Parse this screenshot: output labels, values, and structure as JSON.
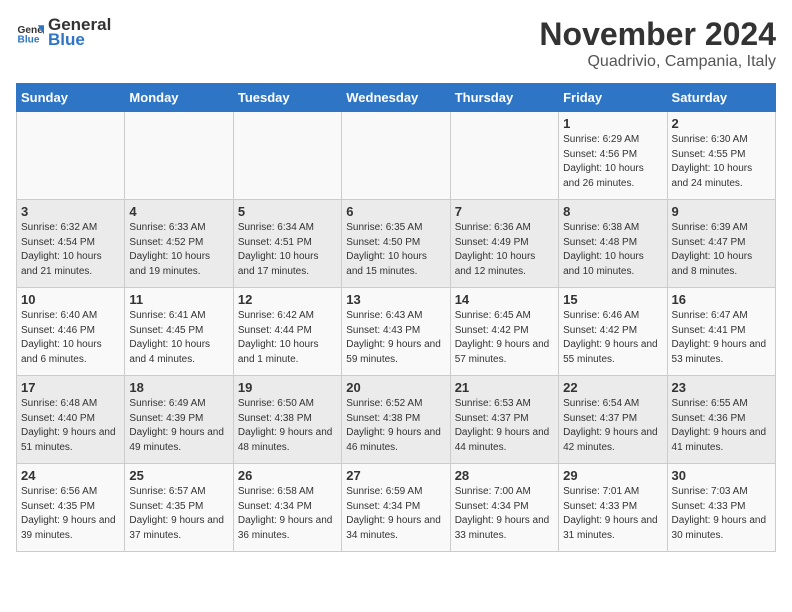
{
  "header": {
    "logo_general": "General",
    "logo_blue": "Blue",
    "title": "November 2024",
    "subtitle": "Quadrivio, Campania, Italy"
  },
  "days_of_week": [
    "Sunday",
    "Monday",
    "Tuesday",
    "Wednesday",
    "Thursday",
    "Friday",
    "Saturday"
  ],
  "weeks": [
    [
      {
        "day": "",
        "info": ""
      },
      {
        "day": "",
        "info": ""
      },
      {
        "day": "",
        "info": ""
      },
      {
        "day": "",
        "info": ""
      },
      {
        "day": "",
        "info": ""
      },
      {
        "day": "1",
        "info": "Sunrise: 6:29 AM\nSunset: 4:56 PM\nDaylight: 10 hours and 26 minutes."
      },
      {
        "day": "2",
        "info": "Sunrise: 6:30 AM\nSunset: 4:55 PM\nDaylight: 10 hours and 24 minutes."
      }
    ],
    [
      {
        "day": "3",
        "info": "Sunrise: 6:32 AM\nSunset: 4:54 PM\nDaylight: 10 hours and 21 minutes."
      },
      {
        "day": "4",
        "info": "Sunrise: 6:33 AM\nSunset: 4:52 PM\nDaylight: 10 hours and 19 minutes."
      },
      {
        "day": "5",
        "info": "Sunrise: 6:34 AM\nSunset: 4:51 PM\nDaylight: 10 hours and 17 minutes."
      },
      {
        "day": "6",
        "info": "Sunrise: 6:35 AM\nSunset: 4:50 PM\nDaylight: 10 hours and 15 minutes."
      },
      {
        "day": "7",
        "info": "Sunrise: 6:36 AM\nSunset: 4:49 PM\nDaylight: 10 hours and 12 minutes."
      },
      {
        "day": "8",
        "info": "Sunrise: 6:38 AM\nSunset: 4:48 PM\nDaylight: 10 hours and 10 minutes."
      },
      {
        "day": "9",
        "info": "Sunrise: 6:39 AM\nSunset: 4:47 PM\nDaylight: 10 hours and 8 minutes."
      }
    ],
    [
      {
        "day": "10",
        "info": "Sunrise: 6:40 AM\nSunset: 4:46 PM\nDaylight: 10 hours and 6 minutes."
      },
      {
        "day": "11",
        "info": "Sunrise: 6:41 AM\nSunset: 4:45 PM\nDaylight: 10 hours and 4 minutes."
      },
      {
        "day": "12",
        "info": "Sunrise: 6:42 AM\nSunset: 4:44 PM\nDaylight: 10 hours and 1 minute."
      },
      {
        "day": "13",
        "info": "Sunrise: 6:43 AM\nSunset: 4:43 PM\nDaylight: 9 hours and 59 minutes."
      },
      {
        "day": "14",
        "info": "Sunrise: 6:45 AM\nSunset: 4:42 PM\nDaylight: 9 hours and 57 minutes."
      },
      {
        "day": "15",
        "info": "Sunrise: 6:46 AM\nSunset: 4:42 PM\nDaylight: 9 hours and 55 minutes."
      },
      {
        "day": "16",
        "info": "Sunrise: 6:47 AM\nSunset: 4:41 PM\nDaylight: 9 hours and 53 minutes."
      }
    ],
    [
      {
        "day": "17",
        "info": "Sunrise: 6:48 AM\nSunset: 4:40 PM\nDaylight: 9 hours and 51 minutes."
      },
      {
        "day": "18",
        "info": "Sunrise: 6:49 AM\nSunset: 4:39 PM\nDaylight: 9 hours and 49 minutes."
      },
      {
        "day": "19",
        "info": "Sunrise: 6:50 AM\nSunset: 4:38 PM\nDaylight: 9 hours and 48 minutes."
      },
      {
        "day": "20",
        "info": "Sunrise: 6:52 AM\nSunset: 4:38 PM\nDaylight: 9 hours and 46 minutes."
      },
      {
        "day": "21",
        "info": "Sunrise: 6:53 AM\nSunset: 4:37 PM\nDaylight: 9 hours and 44 minutes."
      },
      {
        "day": "22",
        "info": "Sunrise: 6:54 AM\nSunset: 4:37 PM\nDaylight: 9 hours and 42 minutes."
      },
      {
        "day": "23",
        "info": "Sunrise: 6:55 AM\nSunset: 4:36 PM\nDaylight: 9 hours and 41 minutes."
      }
    ],
    [
      {
        "day": "24",
        "info": "Sunrise: 6:56 AM\nSunset: 4:35 PM\nDaylight: 9 hours and 39 minutes."
      },
      {
        "day": "25",
        "info": "Sunrise: 6:57 AM\nSunset: 4:35 PM\nDaylight: 9 hours and 37 minutes."
      },
      {
        "day": "26",
        "info": "Sunrise: 6:58 AM\nSunset: 4:34 PM\nDaylight: 9 hours and 36 minutes."
      },
      {
        "day": "27",
        "info": "Sunrise: 6:59 AM\nSunset: 4:34 PM\nDaylight: 9 hours and 34 minutes."
      },
      {
        "day": "28",
        "info": "Sunrise: 7:00 AM\nSunset: 4:34 PM\nDaylight: 9 hours and 33 minutes."
      },
      {
        "day": "29",
        "info": "Sunrise: 7:01 AM\nSunset: 4:33 PM\nDaylight: 9 hours and 31 minutes."
      },
      {
        "day": "30",
        "info": "Sunrise: 7:03 AM\nSunset: 4:33 PM\nDaylight: 9 hours and 30 minutes."
      }
    ]
  ]
}
